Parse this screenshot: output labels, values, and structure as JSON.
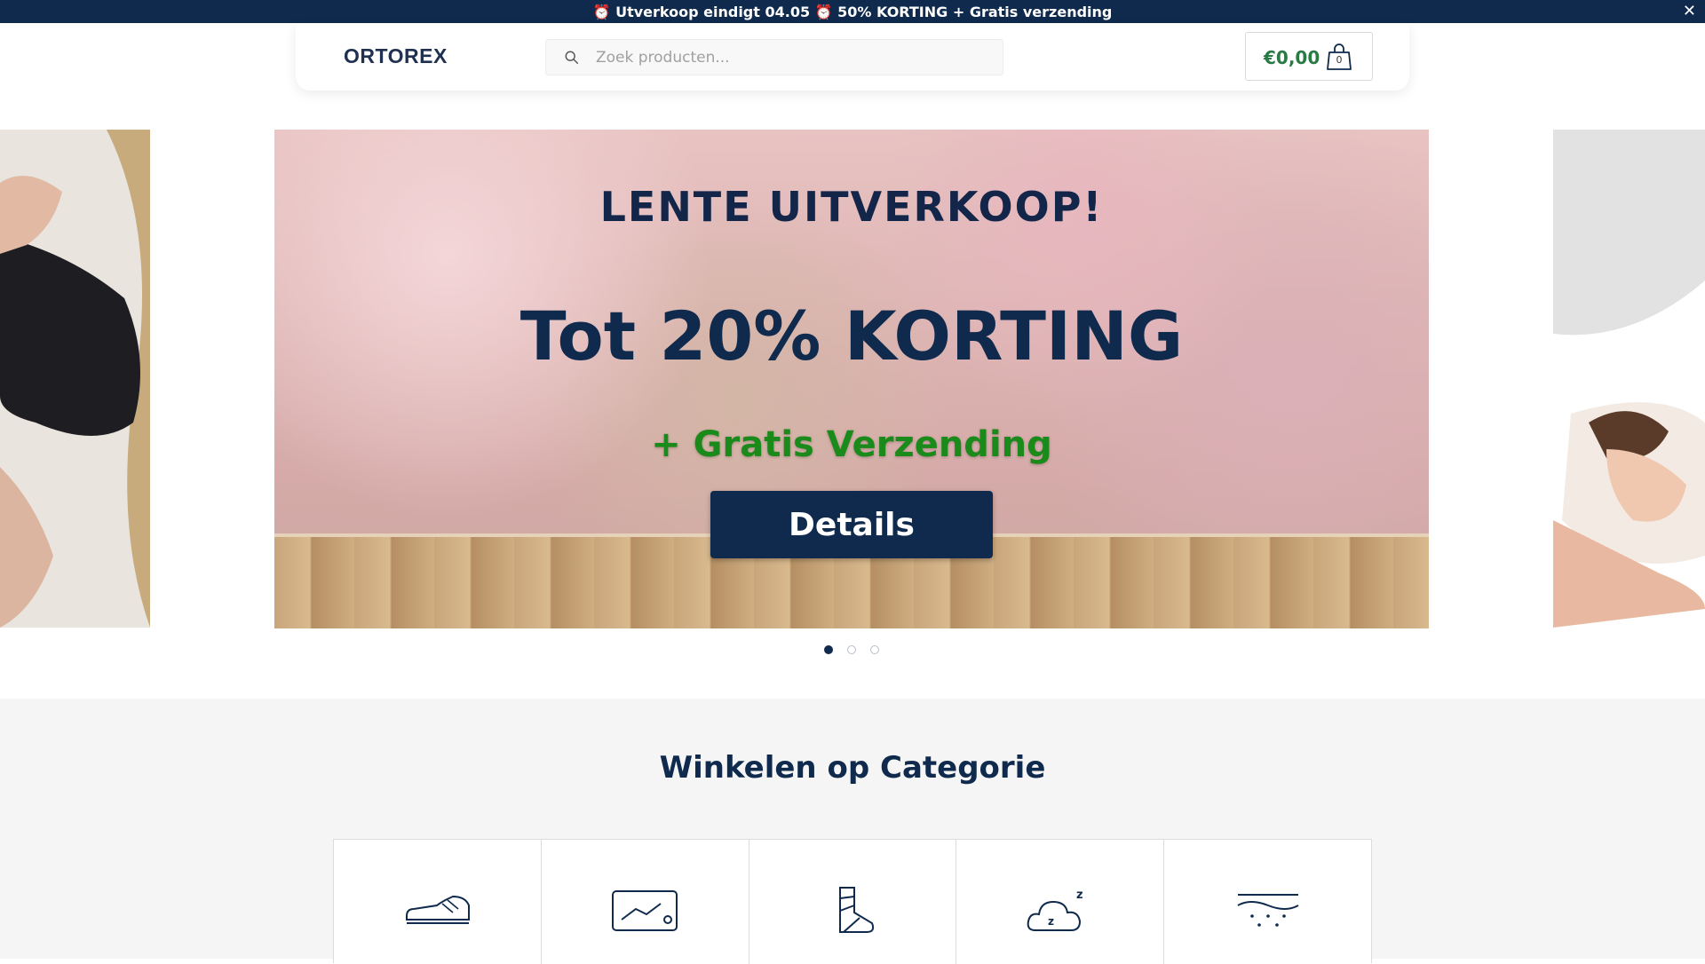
{
  "announcement": {
    "text": "⏰ Utverkoop eindigt 04.05 ⏰ 50% KORTING + Gratis verzending",
    "close_label": "✕"
  },
  "header": {
    "logo": "ORTOREX",
    "search_placeholder": "Zoek producten...",
    "cart_amount": "€0,00",
    "cart_count": "0"
  },
  "hero": {
    "title": "LENTE UITVERKOOP!",
    "discount": "Tot 20% KORTING",
    "shipping": "+ Gratis Verzending",
    "button_label": "Details"
  },
  "carousel": {
    "slides": 3,
    "active_index": 0
  },
  "categories": {
    "title": "Winkelen op Categorie",
    "icons": [
      "shoe-icon",
      "insole-icon",
      "sock-icon",
      "sleep-cloud-icon",
      "foam-mattress-icon"
    ]
  },
  "colors": {
    "brand_navy": "#0f2a4d",
    "price_green": "#2a7a45",
    "shipping_green": "#1a8a1a"
  }
}
